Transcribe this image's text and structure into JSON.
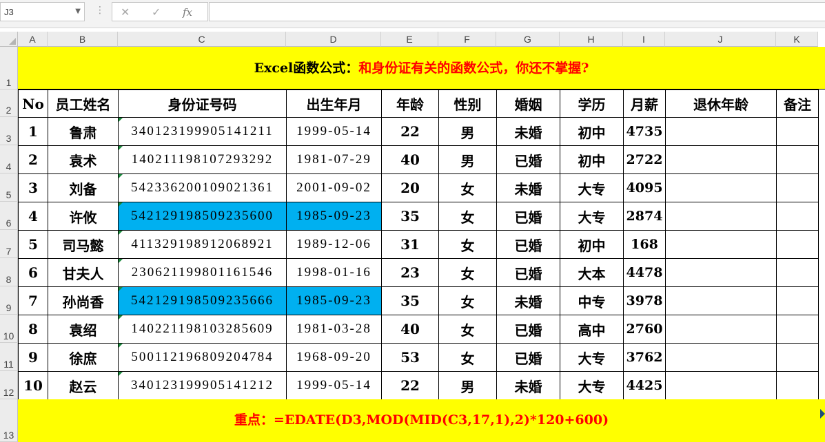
{
  "formula_bar": {
    "name_box": "J3",
    "cancel_icon": "✕",
    "enter_icon": "✓",
    "fx_label": "fx",
    "formula": ""
  },
  "columns": [
    "A",
    "B",
    "C",
    "D",
    "E",
    "F",
    "G",
    "H",
    "I",
    "J",
    "K"
  ],
  "rows": [
    "1",
    "2",
    "3",
    "4",
    "5",
    "6",
    "7",
    "8",
    "9",
    "10",
    "11",
    "12",
    "13"
  ],
  "title": {
    "black": "Excel函数公式：",
    "red": "和身份证有关的函数公式，你还不掌握?"
  },
  "table": {
    "headers": [
      "No",
      "员工姓名",
      "身份证号码",
      "出生年月",
      "年龄",
      "性别",
      "婚姻",
      "学历",
      "月薪",
      "退休年龄",
      "备注"
    ],
    "rows": [
      [
        "1",
        "鲁肃",
        "340123199905141211",
        "1999-05-14",
        "22",
        "男",
        "未婚",
        "初中",
        "4735",
        "",
        ""
      ],
      [
        "2",
        "袁术",
        "140211198107293292",
        "1981-07-29",
        "40",
        "男",
        "已婚",
        "初中",
        "2722",
        "",
        ""
      ],
      [
        "3",
        "刘备",
        "542336200109021361",
        "2001-09-02",
        "20",
        "女",
        "未婚",
        "大专",
        "4095",
        "",
        ""
      ],
      [
        "4",
        "许攸",
        "542129198509235600",
        "1985-09-23",
        "35",
        "女",
        "已婚",
        "大专",
        "2874",
        "",
        ""
      ],
      [
        "5",
        "司马懿",
        "411329198912068921",
        "1989-12-06",
        "31",
        "女",
        "已婚",
        "初中",
        "168",
        "",
        ""
      ],
      [
        "6",
        "甘夫人",
        "230621199801161546",
        "1998-01-16",
        "23",
        "女",
        "已婚",
        "大本",
        "4478",
        "",
        ""
      ],
      [
        "7",
        "孙尚香",
        "542129198509235666",
        "1985-09-23",
        "35",
        "女",
        "未婚",
        "中专",
        "3978",
        "",
        ""
      ],
      [
        "8",
        "袁绍",
        "140221198103285609",
        "1981-03-28",
        "40",
        "女",
        "已婚",
        "高中",
        "2760",
        "",
        ""
      ],
      [
        "9",
        "徐庶",
        "500112196809204784",
        "1968-09-20",
        "53",
        "女",
        "已婚",
        "大专",
        "3762",
        "",
        ""
      ],
      [
        "10",
        "赵云",
        "340123199905141212",
        "1999-05-14",
        "22",
        "男",
        "未婚",
        "大专",
        "4425",
        "",
        ""
      ]
    ],
    "highlight_color": "#00b0f0"
  },
  "footer": {
    "label": "重点：",
    "formula": "=EDATE(D3,MOD(MID(C3,17,1),2)*120+600)"
  },
  "colors": {
    "banner": "#ffff00",
    "title_red": "#ff0000",
    "error_triangle": "#1a8a3c"
  }
}
